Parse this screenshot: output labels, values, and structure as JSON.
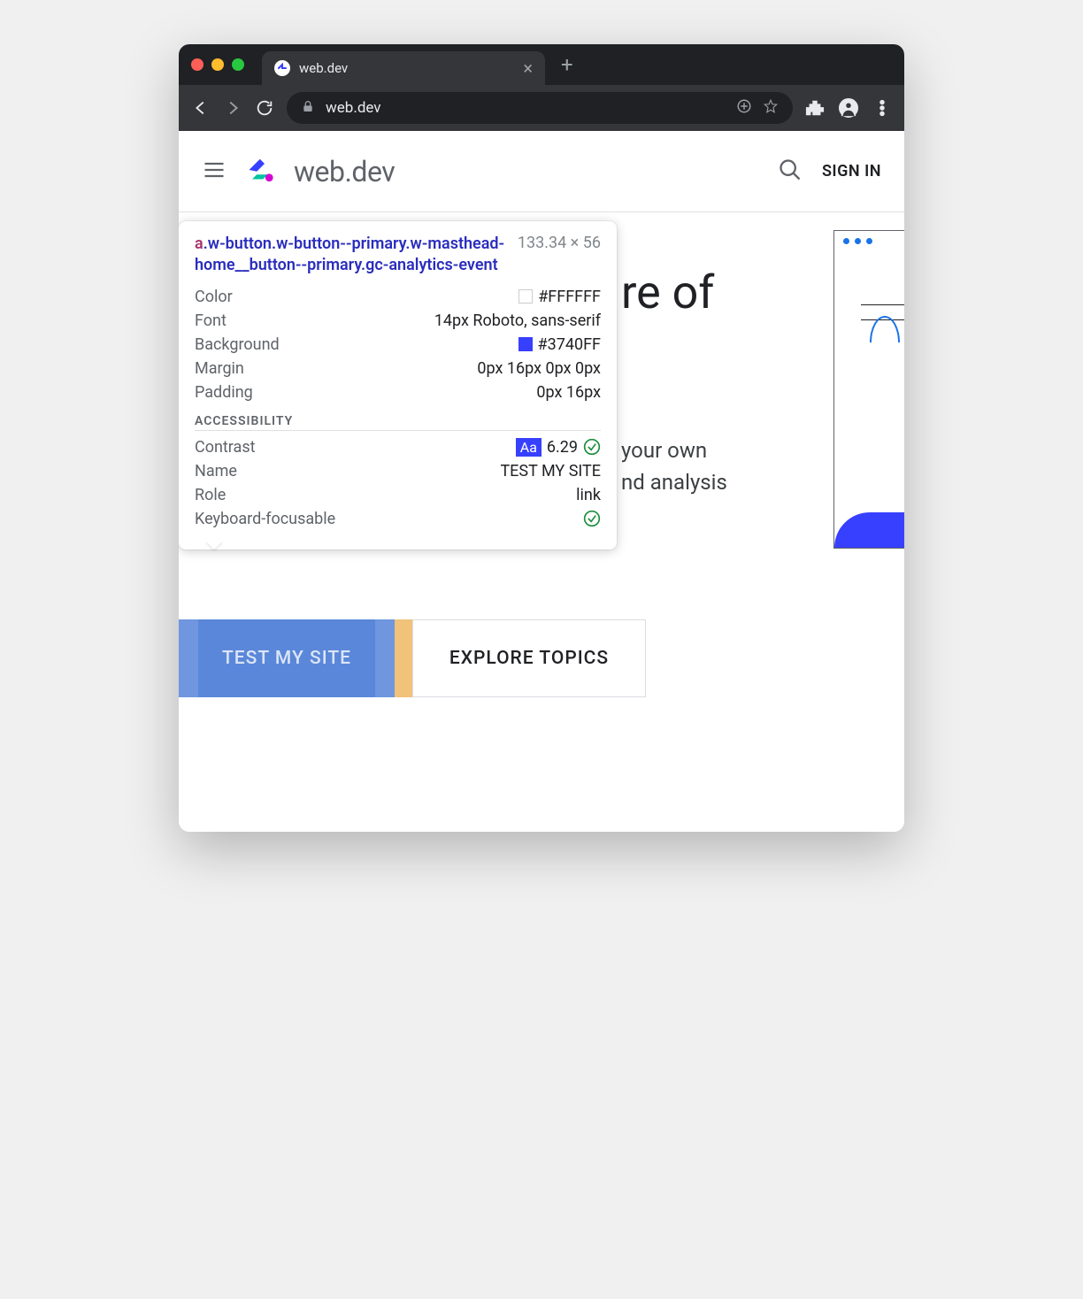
{
  "browser": {
    "tab_title": "web.dev",
    "url": "web.dev"
  },
  "header": {
    "logo_text": "web.dev",
    "signin": "SIGN IN"
  },
  "hero": {
    "title_fragment": "re of",
    "sub_line1": "your own",
    "sub_line2": "nd analysis"
  },
  "tooltip": {
    "tag": "a",
    "classes": ".w-button.w-button--primary.w-masthead-home__button--primary.gc-analytics-event",
    "dimensions": "133.34 × 56",
    "rows": {
      "color_label": "Color",
      "color_value": "#FFFFFF",
      "color_swatch": "#FFFFFF",
      "font_label": "Font",
      "font_value": "14px Roboto, sans-serif",
      "background_label": "Background",
      "background_value": "#3740FF",
      "background_swatch": "#3740FF",
      "margin_label": "Margin",
      "margin_value": "0px 16px 0px 0px",
      "padding_label": "Padding",
      "padding_value": "0px 16px"
    },
    "accessibility_heading": "ACCESSIBILITY",
    "a11y": {
      "contrast_label": "Contrast",
      "contrast_value": "6.29",
      "contrast_badge": "Aa",
      "name_label": "Name",
      "name_value": "TEST MY SITE",
      "role_label": "Role",
      "role_value": "link",
      "keyboard_label": "Keyboard-focusable"
    }
  },
  "buttons": {
    "primary": "TEST MY SITE",
    "secondary": "EXPLORE TOPICS"
  }
}
